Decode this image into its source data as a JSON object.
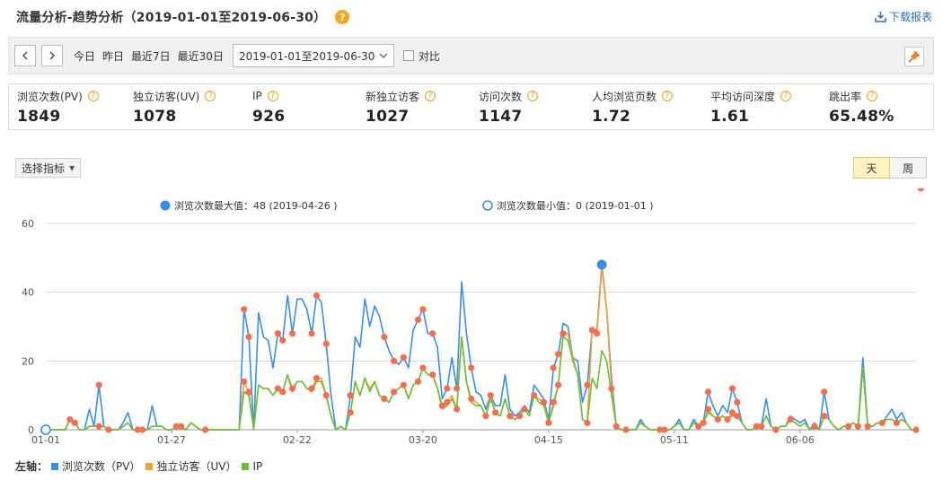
{
  "header": {
    "title": "流量分析-趋势分析（2019-01-01至2019-06-30）",
    "help_icon": "?",
    "download_label": "下载报表"
  },
  "toolbar": {
    "prev": "<",
    "next": ">",
    "quick_dates": [
      "今日",
      "昨日",
      "最近7日",
      "最近30日"
    ],
    "date_range": "2019-01-01至2019-06-30",
    "compare_label": "对比"
  },
  "metrics": [
    {
      "label": "浏览次数(PV)",
      "value": "1849"
    },
    {
      "label": "独立访客(UV)",
      "value": "1078"
    },
    {
      "label": "IP",
      "value": "926"
    },
    {
      "label": "新独立访客",
      "value": "1027"
    },
    {
      "label": "访问次数",
      "value": "1147"
    },
    {
      "label": "人均浏览页数",
      "value": "1.72"
    },
    {
      "label": "平均访问深度",
      "value": "1.61"
    },
    {
      "label": "跳出率",
      "value": "65.48%"
    }
  ],
  "controls": {
    "select_metric": "选择指标",
    "day": "天",
    "week": "周"
  },
  "chart_data": {
    "type": "line",
    "ylim": [
      0,
      60
    ],
    "y_ticks": [
      0,
      20,
      40,
      60
    ],
    "x_tick_labels": [
      "01-01",
      "01-27",
      "02-22",
      "03-20",
      "04-15",
      "05-11",
      "06-06"
    ],
    "x_tick_indices": [
      0,
      26,
      52,
      78,
      104,
      130,
      156
    ],
    "annotation_max": "浏览次数最大值：48 (2019-04-26 )",
    "annotation_min": "浏览次数最小值：0 (2019-01-01 )",
    "max_index": 115,
    "min_index": 0,
    "legend_prefix": "左轴：",
    "series": [
      {
        "name": "浏览次数（PV）",
        "color": "#3a8ee6",
        "values": [
          0,
          0,
          0,
          0,
          0,
          3,
          2,
          0,
          0,
          6,
          1,
          13,
          1,
          0,
          0,
          0,
          2,
          5,
          0,
          0,
          0,
          0,
          7,
          1,
          1,
          0,
          0,
          1,
          1,
          0,
          2,
          1,
          0,
          0,
          0,
          0,
          0,
          0,
          0,
          0,
          0,
          35,
          27,
          0,
          34,
          27,
          26,
          18,
          28,
          26,
          39,
          28,
          38,
          38,
          35,
          28,
          39,
          37,
          25,
          10,
          0,
          1,
          0,
          10,
          27,
          24,
          38,
          30,
          36,
          33,
          27,
          23,
          20,
          19,
          21,
          18,
          29,
          32,
          35,
          28,
          28,
          24,
          9,
          12,
          21,
          12,
          43,
          28,
          18,
          11,
          10,
          6,
          10,
          7,
          7,
          16,
          6,
          4,
          5,
          7,
          5,
          13,
          11,
          9,
          3,
          18,
          22,
          31,
          30,
          21,
          20,
          8,
          13,
          29,
          29,
          48,
          35,
          15,
          1,
          0,
          0,
          0,
          0,
          3,
          1,
          0,
          0,
          0,
          0,
          0,
          1,
          3,
          0,
          0,
          3,
          1,
          2,
          11,
          7,
          4,
          7,
          5,
          12,
          8,
          2,
          0,
          0,
          1,
          1,
          9,
          1,
          0,
          1,
          1,
          4,
          3,
          2,
          3,
          0,
          2,
          0,
          11,
          3,
          1,
          0,
          1,
          1,
          2,
          1,
          21,
          1,
          1,
          2,
          2,
          4,
          6,
          3,
          5,
          2,
          0,
          0
        ]
      },
      {
        "name": "独立访客（UV）",
        "color": "#f0a23a",
        "values": [
          0,
          0,
          0,
          0,
          0,
          3,
          2,
          0,
          0,
          1,
          1,
          1,
          1,
          0,
          0,
          0,
          1,
          2,
          0,
          0,
          0,
          0,
          1,
          1,
          1,
          0,
          0,
          1,
          1,
          0,
          2,
          1,
          0,
          0,
          0,
          0,
          0,
          0,
          0,
          0,
          0,
          14,
          11,
          0,
          13,
          12,
          12,
          10,
          12,
          11,
          16,
          12,
          14,
          14,
          12,
          12,
          15,
          15,
          10,
          4,
          0,
          1,
          0,
          5,
          14,
          10,
          15,
          12,
          14,
          10,
          9,
          8,
          11,
          12,
          13,
          9,
          13,
          14,
          18,
          16,
          16,
          12,
          7,
          8,
          10,
          6,
          27,
          14,
          9,
          8,
          7,
          4,
          10,
          5,
          4,
          9,
          4,
          3,
          4,
          6,
          4,
          10,
          9,
          8,
          2,
          8,
          13,
          28,
          28,
          21,
          16,
          3,
          2,
          29,
          28,
          47,
          35,
          12,
          1,
          0,
          0,
          0,
          0,
          2,
          1,
          0,
          0,
          0,
          0,
          0,
          1,
          2,
          0,
          0,
          2,
          1,
          2,
          6,
          4,
          3,
          4,
          3,
          5,
          4,
          2,
          0,
          0,
          1,
          1,
          4,
          1,
          0,
          1,
          1,
          3,
          2,
          1,
          2,
          0,
          1,
          0,
          4,
          3,
          1,
          0,
          1,
          1,
          2,
          1,
          18,
          1,
          1,
          2,
          2,
          3,
          3,
          2,
          3,
          2,
          0,
          0
        ]
      },
      {
        "name": "IP",
        "color": "#6cbf3b",
        "values": [
          0,
          0,
          0,
          0,
          0,
          3,
          2,
          0,
          0,
          1,
          1,
          1,
          1,
          0,
          0,
          0,
          1,
          2,
          0,
          0,
          0,
          0,
          1,
          1,
          1,
          0,
          0,
          1,
          1,
          0,
          2,
          1,
          0,
          0,
          0,
          0,
          0,
          0,
          0,
          0,
          0,
          11,
          10,
          0,
          13,
          12,
          12,
          10,
          12,
          11,
          16,
          11,
          14,
          14,
          12,
          11,
          14,
          14,
          10,
          4,
          0,
          1,
          0,
          5,
          14,
          10,
          15,
          11,
          14,
          10,
          9,
          8,
          11,
          12,
          13,
          9,
          13,
          14,
          18,
          16,
          16,
          12,
          6,
          7,
          9,
          6,
          27,
          14,
          8,
          7,
          7,
          4,
          9,
          5,
          4,
          9,
          4,
          3,
          4,
          6,
          4,
          10,
          8,
          7,
          2,
          7,
          13,
          27,
          26,
          20,
          16,
          3,
          2,
          15,
          12,
          23,
          20,
          10,
          1,
          0,
          0,
          0,
          0,
          2,
          1,
          0,
          0,
          0,
          0,
          0,
          1,
          2,
          0,
          0,
          2,
          1,
          2,
          5,
          4,
          3,
          4,
          3,
          4,
          4,
          2,
          0,
          0,
          1,
          1,
          4,
          1,
          0,
          1,
          1,
          3,
          2,
          1,
          2,
          0,
          1,
          0,
          4,
          3,
          1,
          0,
          1,
          1,
          2,
          1,
          18,
          1,
          1,
          2,
          2,
          3,
          3,
          2,
          3,
          2,
          0,
          0
        ]
      }
    ],
    "markers": {
      "color": "#f36f4f",
      "indices": [
        0,
        5,
        6,
        11,
        13,
        19,
        20,
        27,
        28,
        33,
        41,
        42,
        48,
        49,
        51,
        55,
        56,
        58,
        63,
        70,
        72,
        74,
        77,
        78,
        80,
        82,
        83,
        85,
        88,
        91,
        92,
        93,
        96,
        98,
        99,
        101,
        103,
        104,
        105,
        106,
        107,
        112,
        113,
        114,
        117,
        118,
        120,
        127,
        128,
        135,
        136,
        137,
        139,
        141,
        142,
        143,
        147,
        148,
        151,
        154,
        159,
        161,
        166,
        168,
        170,
        173,
        176,
        180,
        181
      ]
    }
  }
}
